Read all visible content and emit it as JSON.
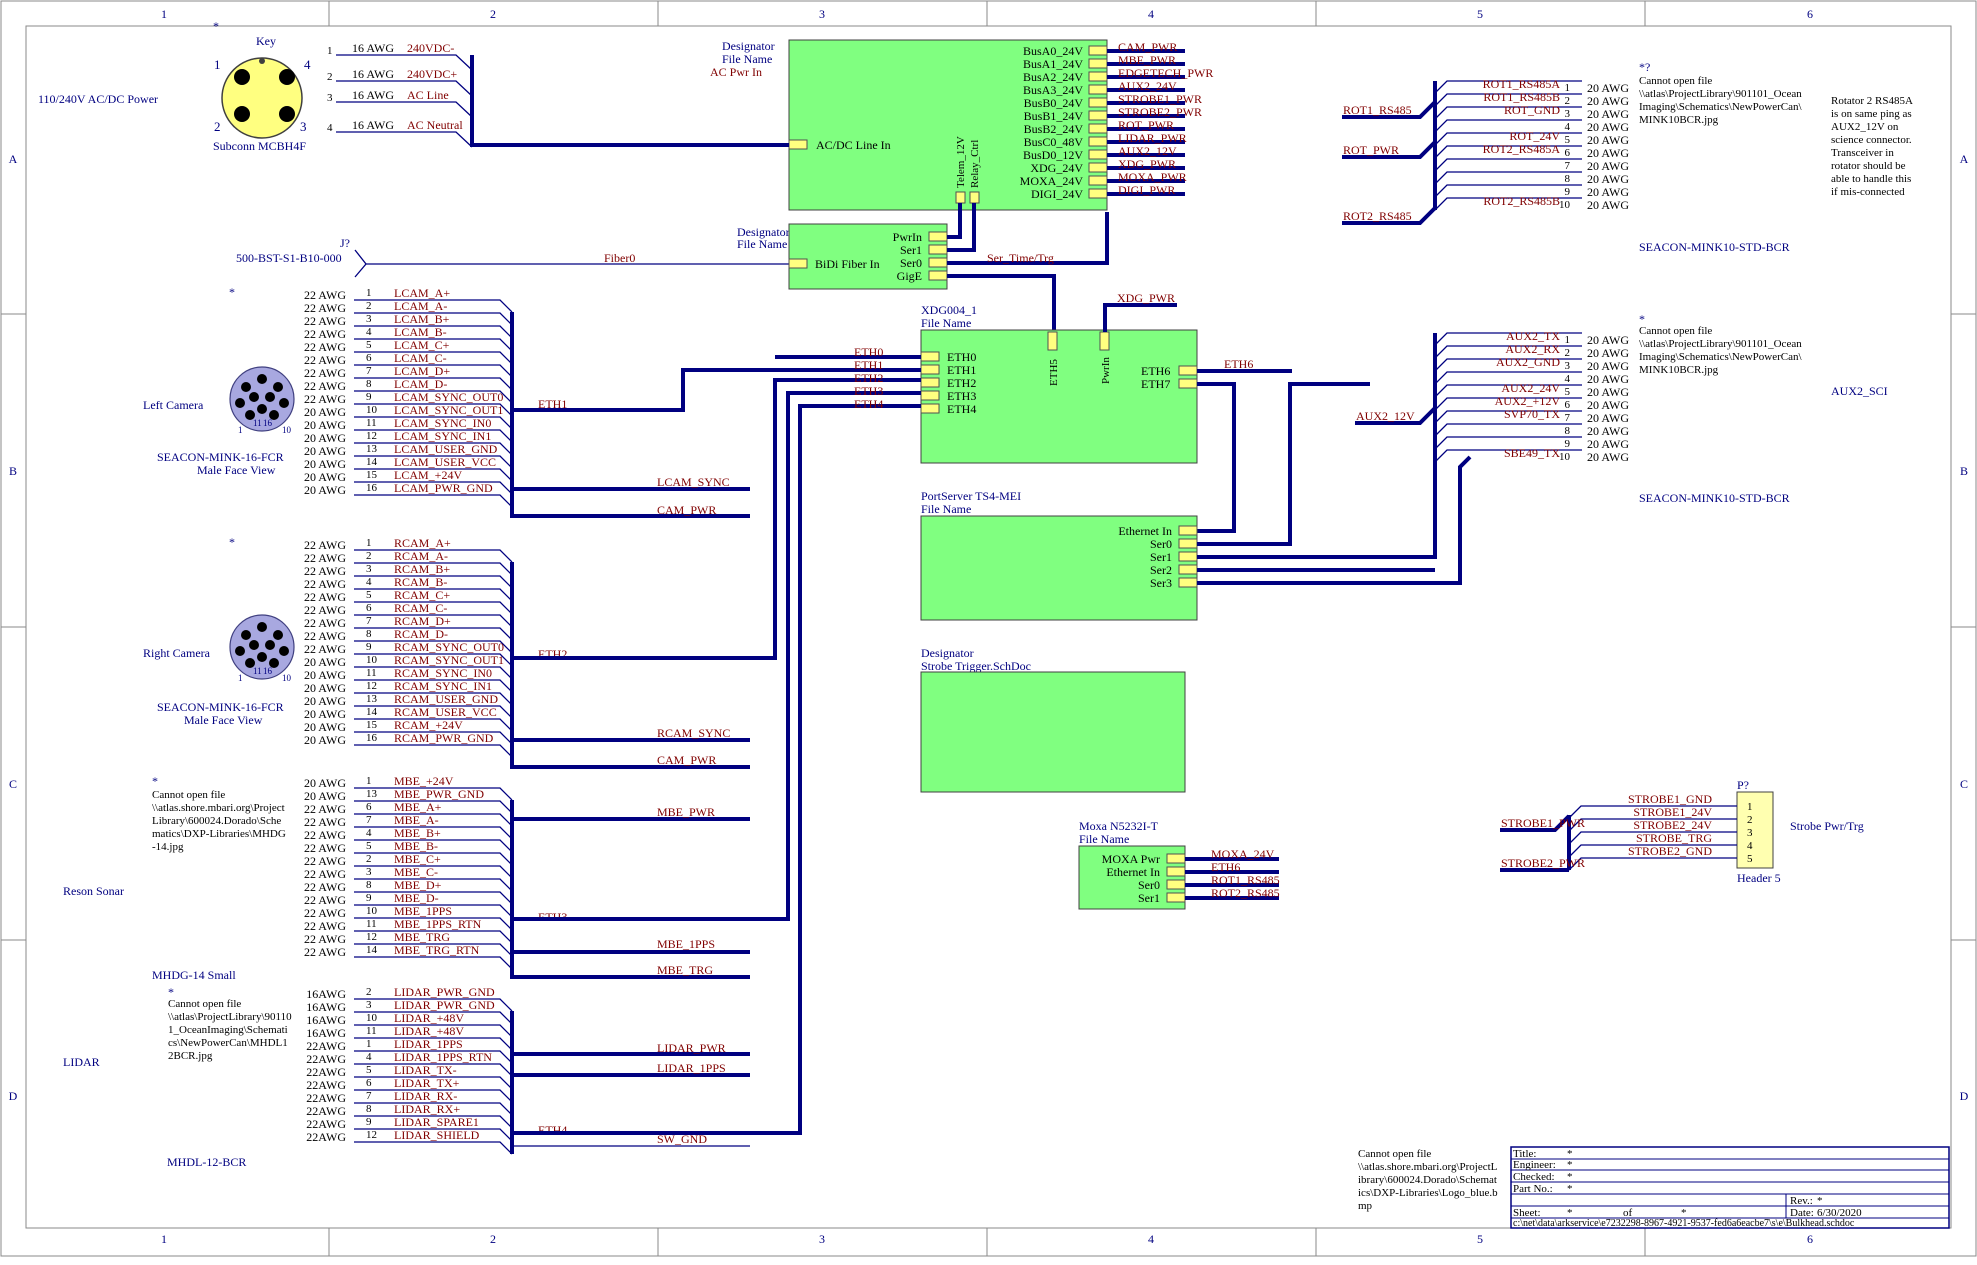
{
  "frame": {
    "columns": [
      "1",
      "2",
      "3",
      "4",
      "5",
      "6"
    ],
    "rows": [
      "A",
      "B",
      "C",
      "D"
    ]
  },
  "power_in": {
    "title": "110/240V AC/DC Power",
    "star": "*",
    "key_label": "Key",
    "key_pins": [
      "1",
      "4",
      "2",
      "3"
    ],
    "connector": "Subconn MCBH4F",
    "pins": [
      "1",
      "2",
      "3",
      "4"
    ],
    "gauges": [
      "16 AWG",
      "16 AWG",
      "16 AWG",
      "16 AWG"
    ],
    "nets": [
      "240VDC-",
      "240VDC+",
      "AC Line",
      "AC Neutral"
    ]
  },
  "ac_pwr": {
    "designator": "Designator",
    "file": "File Name",
    "name": "AC Pwr In",
    "in_port": "AC/DC Line In",
    "out_ports": [
      "BusA0_24V",
      "BusA1_24V",
      "BusA2_24V",
      "BusA3_24V",
      "BusB0_24V",
      "BusB1_24V",
      "BusB2_24V",
      "BusC0_48V",
      "BusD0_12V",
      "XDG_24V",
      "MOXA_24V",
      "DIGI_24V"
    ],
    "out_nets": [
      "CAM_PWR",
      "MBE_PWR",
      "EDGETECH_PWR",
      "AUX2_24V",
      "STROBE1_PWR",
      "STROBE2_PWR",
      "ROT_PWR",
      "LIDAR_PWR",
      "AUX2_12V",
      "XDG_PWR",
      "MOXA_PWR",
      "DIGI_PWR"
    ],
    "bottom_ports": [
      "Telem_12V",
      "Relay_Ctrl"
    ]
  },
  "fiber": {
    "part": "500-BST-S1-B10-000",
    "ref": "J?",
    "net": "Fiber0",
    "designator": "Designator",
    "file": "File Name",
    "in_port": "BiDi Fiber In",
    "out_ports": [
      "PwrIn",
      "Ser1",
      "Ser0",
      "GigE"
    ],
    "ser_net": "Ser_Time/Trg"
  },
  "left_camera": {
    "title": "Left Camera",
    "star": "*",
    "connector": "SEACON-MINK-16-FCR",
    "view": "Male Face View",
    "pin_marks": [
      "1",
      "11",
      "16",
      "10"
    ],
    "gauges": [
      "22 AWG",
      "22 AWG",
      "22 AWG",
      "22 AWG",
      "22 AWG",
      "22 AWG",
      "22 AWG",
      "22 AWG",
      "22 AWG",
      "20 AWG",
      "20 AWG",
      "20 AWG",
      "20 AWG",
      "20 AWG",
      "20 AWG",
      "20 AWG"
    ],
    "pins": [
      "1",
      "2",
      "3",
      "4",
      "5",
      "6",
      "7",
      "8",
      "9",
      "10",
      "11",
      "12",
      "13",
      "14",
      "15",
      "16"
    ],
    "nets": [
      "LCAM_A+",
      "LCAM_A-",
      "LCAM_B+",
      "LCAM_B-",
      "LCAM_C+",
      "LCAM_C-",
      "LCAM_D+",
      "LCAM_D-",
      "LCAM_SYNC_OUT0",
      "LCAM_SYNC_OUT1",
      "LCAM_SYNC_IN0",
      "LCAM_SYNC_IN1",
      "LCAM_USER_GND",
      "LCAM_USER_VCC",
      "LCAM_+24V",
      "LCAM_PWR_GND"
    ],
    "bus": "ETH1",
    "out_nets": [
      "LCAM_SYNC",
      "CAM_PWR"
    ]
  },
  "right_camera": {
    "title": "Right Camera",
    "star": "*",
    "connector": "SEACON-MINK-16-FCR",
    "view": "Male Face View",
    "pin_marks": [
      "1",
      "11",
      "16",
      "10"
    ],
    "gauges": [
      "22 AWG",
      "22 AWG",
      "22 AWG",
      "22 AWG",
      "22 AWG",
      "22 AWG",
      "22 AWG",
      "22 AWG",
      "22 AWG",
      "20 AWG",
      "20 AWG",
      "20 AWG",
      "20 AWG",
      "20 AWG",
      "20 AWG",
      "20 AWG"
    ],
    "pins": [
      "1",
      "2",
      "3",
      "4",
      "5",
      "6",
      "7",
      "8",
      "9",
      "10",
      "11",
      "12",
      "13",
      "14",
      "15",
      "16"
    ],
    "nets": [
      "RCAM_A+",
      "RCAM_A-",
      "RCAM_B+",
      "RCAM_B-",
      "RCAM_C+",
      "RCAM_C-",
      "RCAM_D+",
      "RCAM_D-",
      "RCAM_SYNC_OUT0",
      "RCAM_SYNC_OUT1",
      "RCAM_SYNC_IN0",
      "RCAM_SYNC_IN1",
      "RCAM_USER_GND",
      "RCAM_USER_VCC",
      "RCAM_+24V",
      "RCAM_PWR_GND"
    ],
    "bus": "ETH2",
    "out_nets": [
      "RCAM_SYNC",
      "CAM_PWR"
    ]
  },
  "reson": {
    "title": "Reson Sonar",
    "star": "*",
    "missing_lines": [
      "Cannot open file",
      "\\\\atlas.shore.mbari.org\\Project",
      "Library\\600024.Dorado\\Sche",
      "matics\\DXP-Libraries\\MHDG",
      "-14.jpg"
    ],
    "connector": "MHDG-14 Small",
    "gauges": [
      "20 AWG",
      "20 AWG",
      "22 AWG",
      "22 AWG",
      "22 AWG",
      "22 AWG",
      "22 AWG",
      "22 AWG",
      "22 AWG",
      "22 AWG",
      "22 AWG",
      "22 AWG",
      "22 AWG",
      "22 AWG"
    ],
    "pins": [
      "1",
      "13",
      "6",
      "7",
      "4",
      "5",
      "2",
      "3",
      "8",
      "9",
      "10",
      "11",
      "12",
      "14"
    ],
    "nets": [
      "MBE_+24V",
      "MBE_PWR_GND",
      "MBE_A+",
      "MBE_A-",
      "MBE_B+",
      "MBE_B-",
      "MBE_C+",
      "MBE_C-",
      "MBE_D+",
      "MBE_D-",
      "MBE_1PPS",
      "MBE_1PPS_RTN",
      "MBE_TRG",
      "MBE_TRG_RTN"
    ],
    "bus": "ETH3",
    "out_nets": [
      "MBE_PWR",
      "MBE_1PPS",
      "MBE_TRG"
    ]
  },
  "lidar": {
    "title": "LIDAR",
    "star": "*",
    "missing_lines": [
      "Cannot open file",
      "\\\\atlas\\ProjectLibrary\\90110",
      "1_OceanImaging\\Schemati",
      "cs\\NewPowerCan\\MHDL1",
      "2BCR.jpg"
    ],
    "connector": "MHDL-12-BCR",
    "gauges": [
      "16AWG",
      "16AWG",
      "16AWG",
      "16AWG",
      "22AWG",
      "22AWG",
      "22AWG",
      "22AWG",
      "22AWG",
      "22AWG",
      "22AWG",
      "22AWG"
    ],
    "pins": [
      "2",
      "3",
      "10",
      "11",
      "1",
      "4",
      "5",
      "6",
      "7",
      "8",
      "9",
      "12"
    ],
    "nets": [
      "LIDAR_PWR_GND",
      "LIDAR_PWR_GND",
      "LIDAR_+48V",
      "LIDAR_+48V",
      "LIDAR_1PPS",
      "LIDAR_1PPS_RTN",
      "LIDAR_TX-",
      "LIDAR_TX+",
      "LIDAR_RX-",
      "LIDAR_RX+",
      "LIDAR_SPARE1",
      "LIDAR_SHIELD"
    ],
    "bus": "ETH4",
    "out_nets": [
      "LIDAR_PWR",
      "LIDAR_1PPS",
      "SW_GND"
    ]
  },
  "xdg": {
    "title": "XDG004_1",
    "file": "File Name",
    "left_ports": [
      "ETH0",
      "ETH1",
      "ETH2",
      "ETH3",
      "ETH4"
    ],
    "left_nets": [
      "ETH0",
      "ETH1",
      "ETH2",
      "ETH3",
      "ETH4"
    ],
    "top_ports": [
      "ETH5",
      "PwrIn"
    ],
    "top_net": "XDG_PWR",
    "right_ports": [
      "ETH6",
      "ETH7"
    ],
    "right_net": "ETH6"
  },
  "portserver": {
    "title": "PortServer TS4-MEI",
    "file": "File Name",
    "ports": [
      "Ethernet In",
      "Ser0",
      "Ser1",
      "Ser2",
      "Ser3"
    ]
  },
  "strobe_sheet": {
    "designator": "Designator",
    "file": "Strobe Trigger.SchDoc"
  },
  "moxa": {
    "title": "Moxa N5232I-T",
    "file": "File Name",
    "ports": [
      "MOXA Pwr",
      "Ethernet In",
      "Ser0",
      "Ser1"
    ],
    "nets": [
      "MOXA_24V",
      "ETH6",
      "ROT1_RS485",
      "ROT2_RS485"
    ]
  },
  "rotator": {
    "star": "*?",
    "missing_lines": [
      "Cannot open file",
      "\\\\atlas\\ProjectLibrary\\901101_Ocean",
      "Imaging\\Schematics\\NewPowerCan\\",
      "MINK10BCR.jpg"
    ],
    "connector": "SEACON-MINK10-STD-BCR",
    "bus_labels": [
      "ROT1_RS485",
      "ROT_PWR",
      "ROT2_RS485"
    ],
    "nets": [
      "ROT1_RS485A",
      "ROT1_RS485B",
      "ROT_GND",
      "",
      "ROT_24V",
      "ROT2_RS485A",
      "",
      "",
      "",
      "ROT2_RS485B"
    ],
    "pins": [
      "1",
      "2",
      "3",
      "4",
      "5",
      "6",
      "7",
      "8",
      "9",
      "10"
    ],
    "gauges": [
      "20 AWG",
      "20 AWG",
      "20 AWG",
      "20 AWG",
      "20 AWG",
      "20 AWG",
      "20 AWG",
      "20 AWG",
      "20 AWG",
      "20 AWG"
    ],
    "note": [
      "Rotator 2 RS485A",
      "is on same ping as",
      "AUX2_12V on",
      "science connector.",
      "Transceiver in",
      "rotator should be",
      "able to handle this",
      "if mis-connected"
    ]
  },
  "aux2": {
    "star": "*",
    "missing_lines": [
      "Cannot open file",
      "\\\\atlas\\ProjectLibrary\\901101_Ocean",
      "Imaging\\Schematics\\NewPowerCan\\",
      "MINK10BCR.jpg"
    ],
    "connector": "SEACON-MINK10-STD-BCR",
    "title": "AUX2_SCI",
    "bus_label": "AUX2_12V",
    "nets": [
      "AUX2_TX",
      "AUX2_RX",
      "AUX2_GND",
      "",
      "AUX2_24V",
      "AUX2_+12V",
      "SVP70_TX",
      "",
      "",
      "SBE49_TX"
    ],
    "pins": [
      "1",
      "2",
      "3",
      "4",
      "5",
      "6",
      "7",
      "8",
      "9",
      "10"
    ],
    "gauges": [
      "20 AWG",
      "20 AWG",
      "20 AWG",
      "20 AWG",
      "20 AWG",
      "20 AWG",
      "20 AWG",
      "20 AWG",
      "20 AWG",
      "20 AWG"
    ]
  },
  "strobe_conn": {
    "ref": "P?",
    "name": "Header 5",
    "title": "Strobe Pwr/Trg",
    "pins": [
      "1",
      "2",
      "3",
      "4",
      "5"
    ],
    "nets": [
      "STROBE1_GND",
      "STROBE1_24V",
      "STROBE2_24V",
      "STROBE_TRG",
      "STROBE2_GND"
    ],
    "bus_labels": [
      "STROBE1_PWR",
      "STROBE2_PWR"
    ]
  },
  "logo_missing": [
    "Cannot open file",
    "\\\\atlas.shore.mbari.org\\ProjectL",
    "ibrary\\600024.Dorado\\Schemat",
    "ics\\DXP-Libraries\\Logo_blue.b",
    "mp"
  ],
  "title_block": {
    "title_label": "Title:",
    "title_value": "*",
    "engineer_label": "Engineer:",
    "engineer_value": "*",
    "checked_label": "Checked:",
    "checked_value": "*",
    "partno_label": "Part No.:",
    "partno_value": "*",
    "rev_label": "Rev.:",
    "rev_value": "*",
    "sheet_label": "Sheet:",
    "sheet_value": "*",
    "of_label": "of",
    "of_value": "*",
    "date_label": "Date:",
    "date_value": "6/30/2020",
    "path": "c:\\net\\data\\arkservice\\e7232298-8967-4921-9537-fed6a6eacbe7\\s\\e\\Bulkhead.schdoc"
  }
}
